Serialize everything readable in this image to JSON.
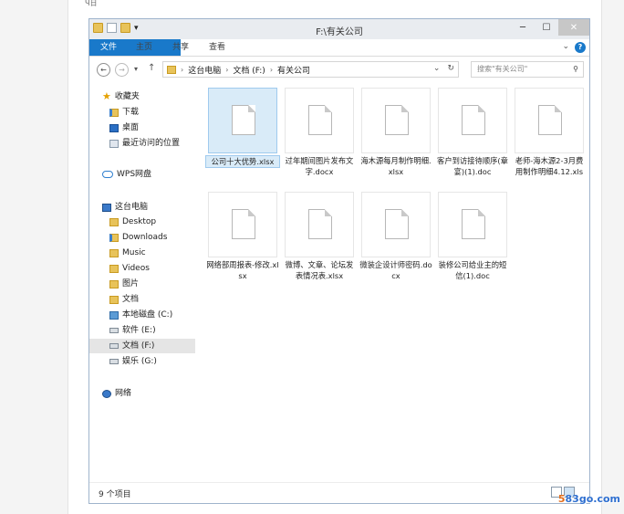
{
  "page": {
    "crumb": "Ч日"
  },
  "window": {
    "title": "F:\\有关公司",
    "quick_access_suffix": "▾",
    "controls": {
      "minimize": "─",
      "maximize": "☐",
      "close": "✕"
    }
  },
  "ribbon": {
    "tabs": [
      "文件",
      "主页",
      "共享",
      "查看"
    ],
    "expand": "⌄",
    "help": "?"
  },
  "nav": {
    "back": "←",
    "forward": "→",
    "recent": "▾",
    "up": "↑",
    "path": [
      "这台电脑",
      "文档 (F:)",
      "有关公司"
    ],
    "path_sep": "›",
    "address_dropdown": "⌄",
    "refresh": "↻",
    "search_placeholder": "搜索\"有关公司\"",
    "search_icon": "⚲"
  },
  "sidebar": {
    "items": [
      {
        "label": "收藏夹",
        "icon": "star-icon"
      },
      {
        "label": "下载",
        "icon": "download-folder-icon"
      },
      {
        "label": "桌面",
        "icon": "desktop-icon"
      },
      {
        "label": "最近访问的位置",
        "icon": "recent-places-icon"
      },
      {
        "label": "WPS网盘",
        "icon": "cloud-icon"
      },
      {
        "label": "这台电脑",
        "icon": "computer-icon"
      },
      {
        "label": "Desktop",
        "icon": "folder-icon"
      },
      {
        "label": "Downloads",
        "icon": "folder-icon"
      },
      {
        "label": "Music",
        "icon": "folder-icon"
      },
      {
        "label": "Videos",
        "icon": "folder-icon"
      },
      {
        "label": "图片",
        "icon": "folder-icon"
      },
      {
        "label": "文档",
        "icon": "folder-icon"
      },
      {
        "label": "本地磁盘 (C:)",
        "icon": "system-drive-icon"
      },
      {
        "label": "软件 (E:)",
        "icon": "drive-icon"
      },
      {
        "label": "文档 (F:)",
        "icon": "drive-icon",
        "selected": true
      },
      {
        "label": "娱乐 (G:)",
        "icon": "drive-icon"
      },
      {
        "label": "网络",
        "icon": "network-icon"
      }
    ]
  },
  "files": [
    {
      "name": "公司十大优势.xlsx",
      "selected": true
    },
    {
      "name": "过年期间图片发布文字.docx"
    },
    {
      "name": "海木源每月制作明细.xlsx"
    },
    {
      "name": "客户到访接待顺序(章宴)(1).doc"
    },
    {
      "name": "老师-海木源2-3月费用制作明细4.12.xls"
    },
    {
      "name": "网络部周报表-修改.xlsx"
    },
    {
      "name": "微博、文章、论坛发表情况表.xlsx"
    },
    {
      "name": "微装企设计师密码.docx"
    },
    {
      "name": "装修公司给业主的短信(1).doc"
    }
  ],
  "status": {
    "item_count": "9 个项目"
  },
  "watermark": {
    "prefix": "5",
    "main": "83go.com"
  },
  "colors": {
    "accent": "#1979ca",
    "selection": "#d9ebf8",
    "selection_border": "#9fcaee"
  }
}
